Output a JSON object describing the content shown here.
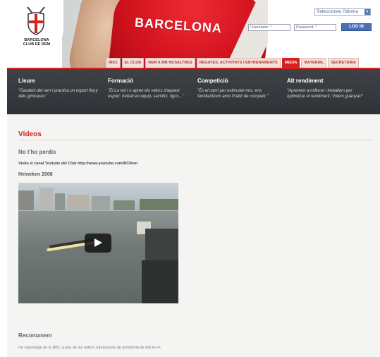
{
  "header": {
    "brand_banner_text": "BARCELONA",
    "logo_text": [
      "BARCELONA",
      "CLUB DE REM"
    ],
    "language_select": "Seleccioneu l'idioma",
    "username_placeholder": "Username: *",
    "password_placeholder": "Password: *",
    "login_label": "LOG IN"
  },
  "tabs": [
    {
      "label": "INICI",
      "active": false
    },
    {
      "label": "EL CLUB",
      "active": false
    },
    {
      "label": "REM A MB NOSALTRES",
      "active": false
    },
    {
      "label": "REGATES, ACTIVITATS I ENTRENAMENTS",
      "active": false
    },
    {
      "label": "MEDIA",
      "active": true
    },
    {
      "label": "MATERIAL",
      "active": false
    },
    {
      "label": "SECRETARIA",
      "active": false
    }
  ],
  "band": {
    "columns": [
      {
        "title": "Lleure",
        "text": "\"Gaudeix del rem i practica un esport lluny dels gimnasos\""
      },
      {
        "title": "Formació",
        "text": "\"El La nol i o apren els valors d'aquest esport: treball en equip, sacrifici, rigor,...\""
      },
      {
        "title": "Competició",
        "text": "\"És el camí per estimular-nos, ens familiaritzem amb l'hàbit de competir.\""
      },
      {
        "title": "Alt rendiment",
        "text": "\"Aprenem a millorar i treballem per optimitzar el rendiment. Volem guanyar!\""
      }
    ]
  },
  "content": {
    "title": "Vídeos",
    "subtitle": "No t'ho perdis",
    "channel_text": "Visita el canal Youtube del Club http://www.youtube.com/BCRem",
    "video_title": "Heineken 2008",
    "recommend_title": "Recomanem",
    "recommend_text": "Un reportatge de la BBC a una de les millors tripulacions de la història de GB en 4-"
  },
  "colors": {
    "brand_red": "#d6211e",
    "band_dark": "#363a3f",
    "login_blue": "#4a6fb3"
  }
}
